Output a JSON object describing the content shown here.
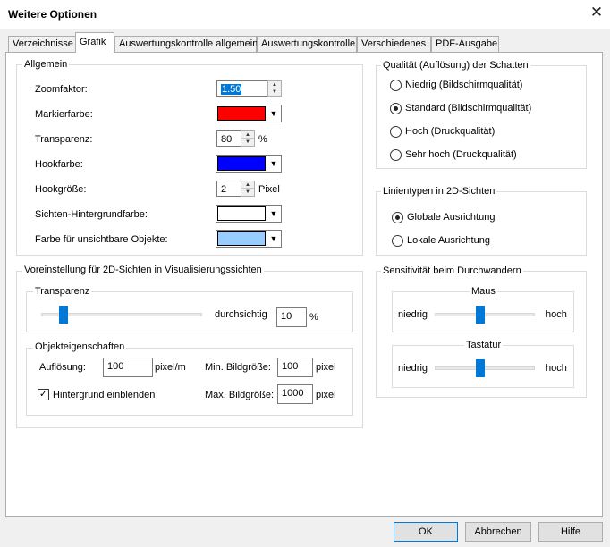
{
  "window": {
    "title": "Weitere Optionen",
    "close_glyph": "✕"
  },
  "tabs": [
    "Verzeichnisse",
    "Grafik",
    "Auswertungskontrolle allgemein",
    "Auswertungskontrolle",
    "Verschiedenes",
    "PDF-Ausgabe"
  ],
  "active_tab": "Grafik",
  "allgemein": {
    "legend": "Allgemein",
    "zoom_label": "Zoomfaktor:",
    "zoom_value": "1.50",
    "marker_label": "Markierfarbe:",
    "marker_color": "#ff0000",
    "transparency_label": "Transparenz:",
    "transparency_value": "80",
    "transparency_unit": "%",
    "hook_color_label": "Hookfarbe:",
    "hook_color": "#0000ff",
    "hook_size_label": "Hookgröße:",
    "hook_size_value": "2",
    "hook_size_unit": "Pixel",
    "bg_color_label": "Sichten-Hintergrundfarbe:",
    "bg_color": "#ffffff",
    "invisible_color_label": "Farbe für unsichtbare Objekte:",
    "invisible_color": "#99ccff"
  },
  "presets_2d": {
    "legend": "Voreinstellung für 2D-Sichten in Visualisierungssichten",
    "transparency_legend": "Transparenz",
    "transparency_fraction": 0.12,
    "slider_label": "durchsichtig",
    "slider_value": "10",
    "slider_unit": "%",
    "object_props_legend": "Objekteigenschaften",
    "resolution_label": "Auflösung:",
    "resolution_value": "100",
    "resolution_unit": "pixel/m",
    "min_size_label": "Min. Bildgröße:",
    "min_size_value": "100",
    "min_size_unit": "pixel",
    "max_size_label": "Max. Bildgröße:",
    "max_size_value": "1000",
    "max_size_unit": "pixel",
    "show_bg_label": "Hintergrund einblenden",
    "show_bg_checked": true
  },
  "shadow_quality": {
    "legend": "Qualität (Auflösung) der Schatten",
    "options": [
      "Niedrig (Bildschirmqualität)",
      "Standard (Bildschirmqualität)",
      "Hoch (Druckqualität)",
      "Sehr hoch (Druckqualität)"
    ],
    "selected_index": 1
  },
  "line_types": {
    "legend": "Linientypen in 2D-Sichten",
    "options": [
      "Globale Ausrichtung",
      "Lokale Ausrichtung"
    ],
    "selected_index": 0
  },
  "sensitivity": {
    "legend": "Sensitivität beim Durchwandern",
    "mouse": {
      "legend": "Maus",
      "low": "niedrig",
      "high": "hoch",
      "fraction": 0.45
    },
    "keyboard": {
      "legend": "Tastatur",
      "low": "niedrig",
      "high": "hoch",
      "fraction": 0.45
    }
  },
  "buttons": {
    "ok": "OK",
    "cancel": "Abbrechen",
    "help": "Hilfe"
  },
  "icons": {
    "close": "close-icon",
    "spin_up": "chevron-up-icon",
    "spin_down": "chevron-down-icon",
    "dropdown": "dropdown-arrow-icon",
    "check": "checkmark-icon"
  }
}
